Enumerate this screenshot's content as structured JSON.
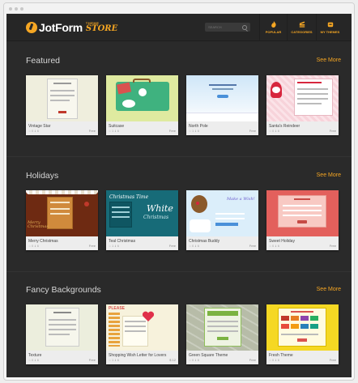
{
  "app": {
    "logo_text": "JotForm",
    "logo_theme": "THEME",
    "logo_store": "STORE",
    "search_placeholder": "SEARCH",
    "nav": {
      "popular": "POPULAR",
      "categories": "CATEGORIES",
      "my_themes": "MY THEMES"
    }
  },
  "colors": {
    "accent": "#f5a623",
    "background": "#2a2a2a"
  },
  "sections": [
    {
      "title": "Featured",
      "see_more": "See More",
      "cards": [
        {
          "name": "Vintage Star",
          "stats": "☆ 0   ⇓ 6",
          "price": "Free"
        },
        {
          "name": "Suitcase",
          "stats": "☆ 1   ⇓ 6",
          "price": "Free"
        },
        {
          "name": "North Pole",
          "stats": "☆ 1   ⇓ 6",
          "price": "Free"
        },
        {
          "name": "Santa's Reindeer",
          "stats": "☆ 0   ⇓ 6",
          "price": "Free"
        }
      ]
    },
    {
      "title": "Holidays",
      "see_more": "See More",
      "cards": [
        {
          "name": "Merry Christmas",
          "stats": "☆ 0   ⇓ 6",
          "price": "Free"
        },
        {
          "name": "Teal Christmas",
          "stats": "☆ 1   ⇓ 6",
          "price": "Free"
        },
        {
          "name": "Christmas Buddy",
          "stats": "☆ 0   ⇓ 6",
          "price": "Free"
        },
        {
          "name": "Sweet Holiday",
          "stats": "☆ 0   ⇓ 6",
          "price": "Free"
        }
      ]
    },
    {
      "title": "Fancy Backgrounds",
      "see_more": "See More",
      "cards": [
        {
          "name": "Texture",
          "stats": "☆ 0   ⇓ 6",
          "price": "Free"
        },
        {
          "name": "Shopping Wish Letter for Lovers",
          "stats": "☆ 1   ⇓ 6",
          "price": "$ 12"
        },
        {
          "name": "Green Square Theme",
          "stats": "☆ 0   ⇓ 6",
          "price": "Free"
        },
        {
          "name": "Fresh Theme",
          "stats": "☆ 0   ⇓ 6",
          "price": "Free"
        }
      ]
    }
  ],
  "thumb_text": {
    "merry": "Merry Christmas",
    "teal_title": "Christmas Time",
    "teal_white": "White",
    "teal_christmas": "Christmas",
    "buddy_script": "Make a Wish!",
    "please": "PLEASE"
  }
}
